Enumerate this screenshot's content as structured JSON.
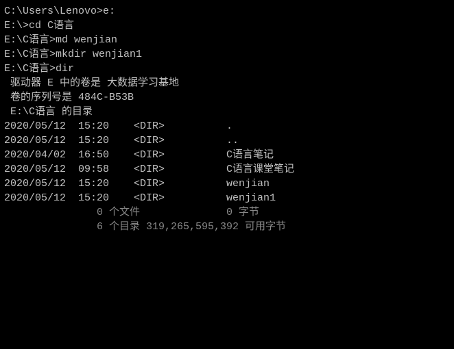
{
  "lines": {
    "l0": "C:\\Users\\Lenovo>e:",
    "l1": "",
    "l2": "E:\\>cd C语言",
    "l3": "",
    "l4": "E:\\C语言>md wenjian",
    "l5": "",
    "l6": "E:\\C语言>mkdir wenjian1",
    "l7": "",
    "l8": "E:\\C语言>dir",
    "l9": " 驱动器 E 中的卷是 大数据学习基地",
    "l10": " 卷的序列号是 484C-B53B",
    "l11": "",
    "l12": " E:\\C语言 的目录",
    "l13": "",
    "l14": "2020/05/12  15:20    <DIR>          .",
    "l15": "2020/05/12  15:20    <DIR>          ..",
    "l16": "2020/04/02  16:50    <DIR>          C语言笔记",
    "l17": "2020/05/12  09:58    <DIR>          C语言课堂笔记",
    "l18": "2020/05/12  15:20    <DIR>          wenjian",
    "l19": "2020/05/12  15:20    <DIR>          wenjian1",
    "l20": "               0 个文件              0 字节",
    "l21": "               6 个目录 319,265,595,392 可用字节"
  }
}
